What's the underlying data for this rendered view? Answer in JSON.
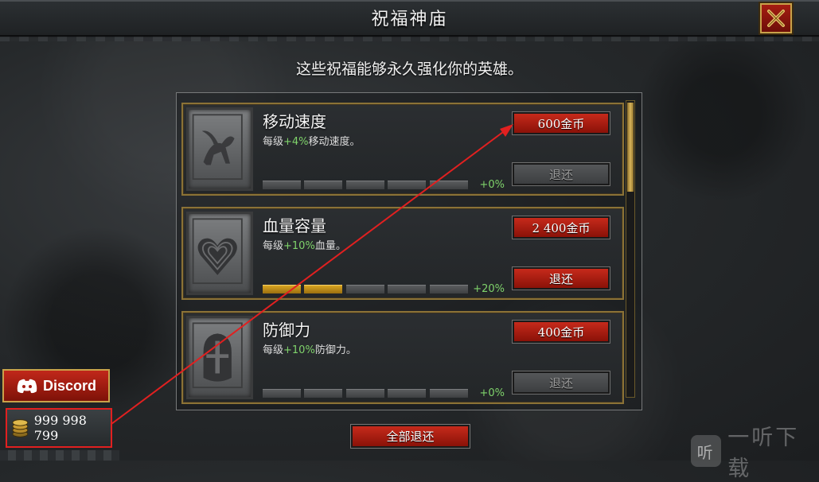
{
  "header": {
    "title": "祝福神庙"
  },
  "subtitle": "这些祝福能够永久强化你的英雄。",
  "blessings": [
    {
      "name": "移动速度",
      "desc_prefix": "每级",
      "desc_pct": "+4%",
      "desc_suffix": "移动速度。",
      "bonus": "+0%",
      "filled": 0,
      "levels": 5,
      "buy_label": "600金币",
      "refund_label": "退还",
      "refund_enabled": false,
      "icon": "pegasus-icon"
    },
    {
      "name": "血量容量",
      "desc_prefix": "每级",
      "desc_pct": "+10%",
      "desc_suffix": "血量。",
      "bonus": "+20%",
      "filled": 2,
      "levels": 5,
      "buy_label": "2 400金币",
      "refund_label": "退还",
      "refund_enabled": true,
      "icon": "heart-icon"
    },
    {
      "name": "防御力",
      "desc_prefix": "每级",
      "desc_pct": "+10%",
      "desc_suffix": "防御力。",
      "bonus": "+0%",
      "filled": 0,
      "levels": 5,
      "buy_label": "400金币",
      "refund_label": "退还",
      "refund_enabled": false,
      "icon": "helmet-icon"
    }
  ],
  "footer": {
    "reset_all_label": "全部退还"
  },
  "social": {
    "discord_label": "Discord"
  },
  "wallet": {
    "gold": "999 998 799"
  },
  "watermark": {
    "logo": "听",
    "text": "一听下载"
  },
  "colors": {
    "accent_red": "#c62a1b",
    "gold_trim": "#c9a24a",
    "bonus_green": "#7fd36b",
    "highlight_red": "#e12020"
  }
}
